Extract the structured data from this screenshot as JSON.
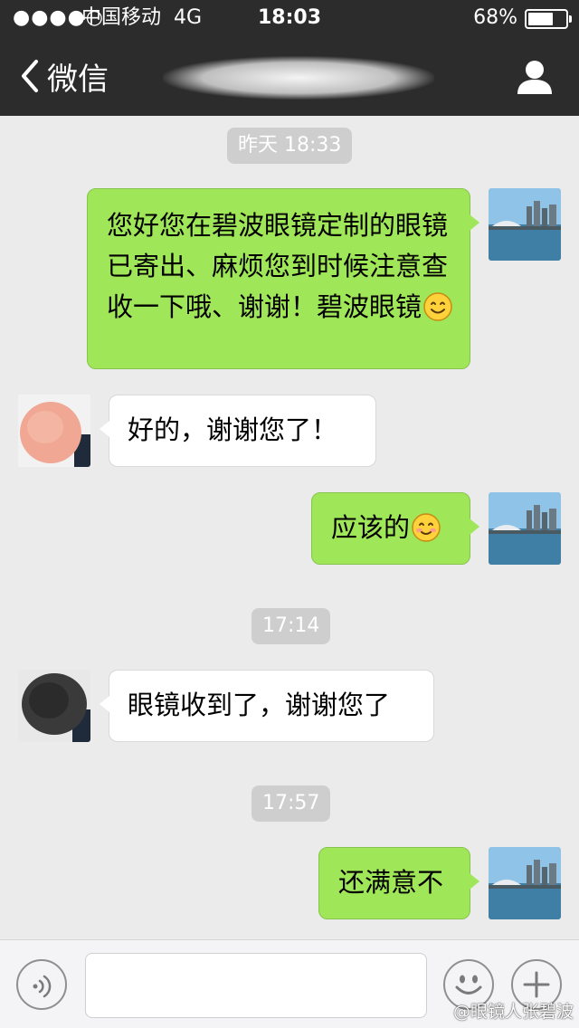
{
  "status_bar": {
    "signal_dots": "●●●●○",
    "carrier": "中国移动",
    "network": "4G",
    "time": "18:03",
    "battery_percent": "68%",
    "battery_level": 0.68
  },
  "nav": {
    "back_label": "微信",
    "back_icon": "chevron-left-icon",
    "profile_icon": "person-icon"
  },
  "messages": [
    {
      "type": "time",
      "text": "昨天 18:33"
    },
    {
      "type": "outgoing",
      "text": "您好您在碧波眼镜定制的眼镜已寄出、麻烦您到时候注意查收一下哦、谢谢！碧波眼镜",
      "emoji": "smile-emoji"
    },
    {
      "type": "incoming",
      "text": "好的，谢谢您了！"
    },
    {
      "type": "outgoing",
      "text": "应该的",
      "emoji": "blush-emoji"
    },
    {
      "type": "time",
      "text": "17:14"
    },
    {
      "type": "incoming",
      "text": "眼镜收到了，谢谢您了"
    },
    {
      "type": "time",
      "text": "17:57"
    },
    {
      "type": "outgoing",
      "text": "还满意不"
    }
  ],
  "input_bar": {
    "voice_icon": "voice-icon",
    "emoji_icon": "emoji-icon",
    "plus_icon": "plus-icon",
    "text_value": ""
  },
  "watermark": "@眼镜人张碧波",
  "colors": {
    "header_bg": "#2c2c2c",
    "chat_bg": "#ebebeb",
    "outgoing_bubble": "#9fe658",
    "incoming_bubble": "#ffffff",
    "time_chip": "#cecece"
  }
}
